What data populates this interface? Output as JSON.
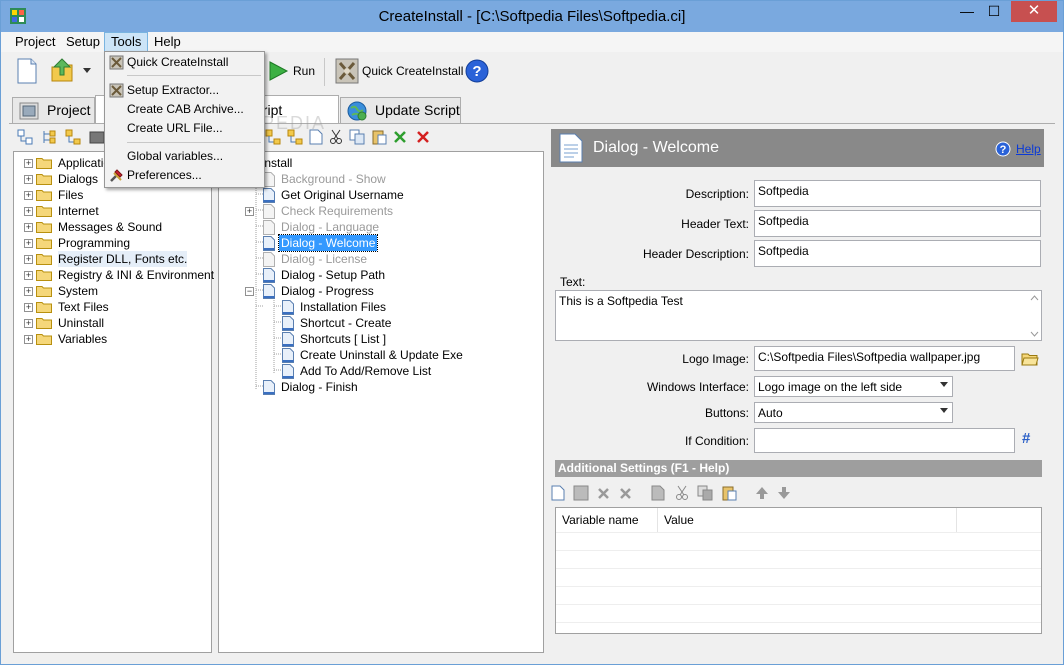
{
  "window": {
    "title": "CreateInstall - [C:\\Softpedia Files\\Softpedia.ci]",
    "min_glyph": "—",
    "max_glyph": "☐",
    "close_glyph": "✕"
  },
  "menubar": {
    "items": [
      "Project",
      "Setup",
      "Tools",
      "Help"
    ]
  },
  "toolbar": {
    "run_label": "Run",
    "quick_label": "Quick CreateInstall"
  },
  "tabs": {
    "project": "Project",
    "install_script": "Install Script",
    "update_script": "Update Script"
  },
  "watermark": "SOFTPEDIA",
  "tools_menu": {
    "items": [
      "Quick CreateInstall",
      "Setup Extractor...",
      "Create CAB Archive...",
      "Create URL File...",
      "Global variables...",
      "Preferences..."
    ]
  },
  "left_tree": {
    "items": [
      "Application",
      "Dialogs",
      "Files",
      "Internet",
      "Messages & Sound",
      "Programming",
      "Register DLL, Fonts etc.",
      "Registry & INI & Environment",
      "System",
      "Text Files",
      "Uninstall",
      "Variables"
    ]
  },
  "script_tree": {
    "root": "Install",
    "items": [
      "Background - Show",
      "Get Original Username",
      "Check Requirements",
      "Dialog - Language",
      "Dialog - Welcome",
      "Dialog - License",
      "Dialog - Setup Path",
      "Dialog - Progress",
      "Installation Files",
      "Shortcut - Create",
      "Shortcuts [ List ]",
      "Create Uninstall & Update Exe",
      "Add To Add/Remove List",
      "Dialog - Finish"
    ]
  },
  "properties": {
    "header_title": "Dialog - Welcome",
    "help_label": "Help",
    "description_label": "Description:",
    "description_value": "Softpedia",
    "header_text_label": "Header Text:",
    "header_text_value": "Softpedia",
    "header_desc_label": "Header Description:",
    "header_desc_value": "Softpedia",
    "text_label": "Text:",
    "text_value": "This is a Softpedia Test",
    "logo_label": "Logo Image:",
    "logo_value": "C:\\Softpedia Files\\Softpedia wallpaper.jpg",
    "interface_label": "Windows Interface:",
    "interface_value": "Logo image on the left side",
    "buttons_label": "Buttons:",
    "buttons_value": "Auto",
    "condition_label": "If Condition:",
    "condition_value": "",
    "condition_glyph": "#"
  },
  "additional": {
    "title": "Additional Settings (F1 - Help)",
    "col_name": "Variable name",
    "col_value": "Value"
  },
  "colors": {
    "titlebar": "#7aa9df",
    "close_button": "#c75050",
    "selection": "#3399ff",
    "panel_header": "#898989"
  }
}
